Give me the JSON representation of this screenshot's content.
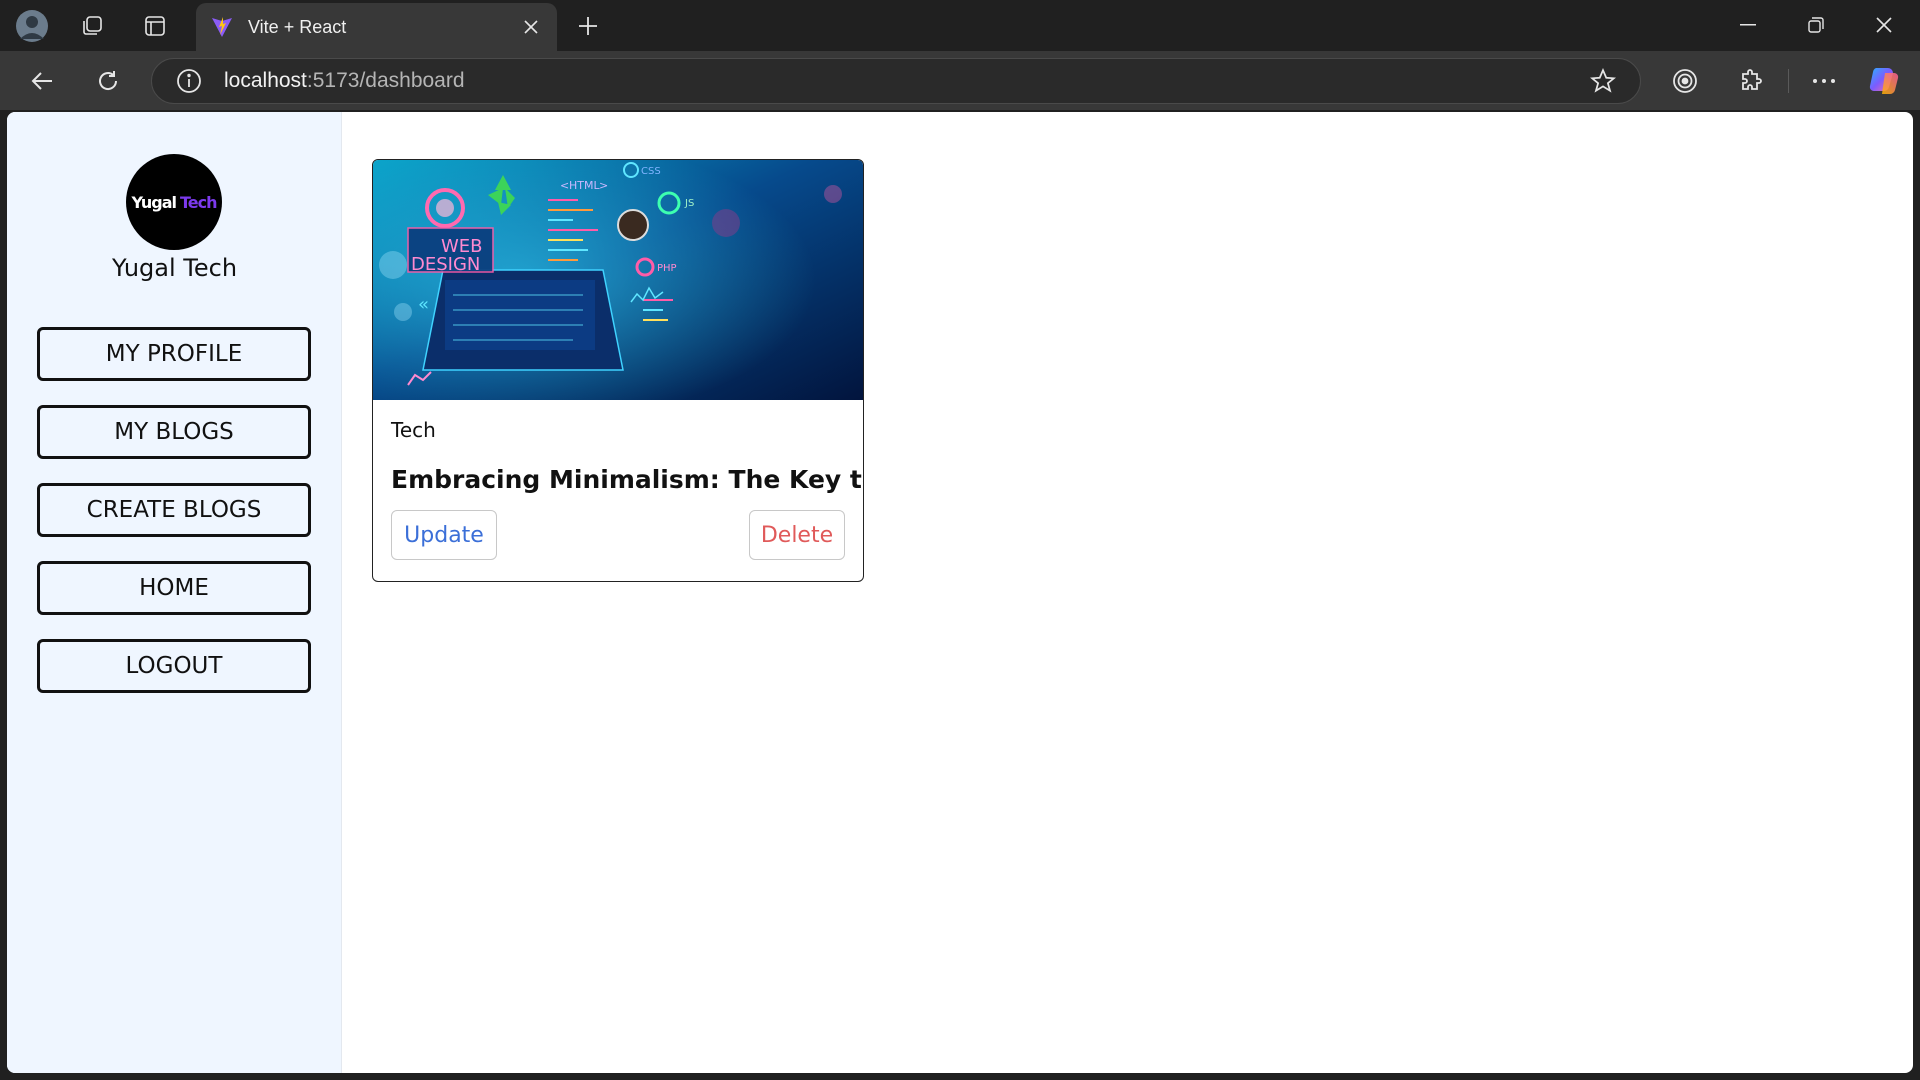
{
  "browser": {
    "tab_title": "Vite + React",
    "url_host": "localhost",
    "url_path": ":5173/dashboard"
  },
  "sidebar": {
    "logo_word1": "Yugal",
    "logo_word2": "Tech",
    "brand_name": "Yugal Tech",
    "items": [
      {
        "label": "MY PROFILE"
      },
      {
        "label": "MY BLOGS"
      },
      {
        "label": "CREATE BLOGS"
      },
      {
        "label": "HOME"
      },
      {
        "label": "LOGOUT"
      }
    ]
  },
  "blogs": [
    {
      "category": "Tech",
      "title": "Embracing Minimalism: The Key to...",
      "update_label": "Update",
      "delete_label": "Delete",
      "image_text": {
        "html": "HTML",
        "css": "CSS",
        "js": "JS",
        "php": "PHP",
        "web": "WEB",
        "design": "DESIGN"
      }
    }
  ],
  "colors": {
    "sidebar_bg": "#eff6ff",
    "update": "#3b6fd8",
    "delete": "#e05a5a",
    "logo_accent": "#7c3aed"
  }
}
